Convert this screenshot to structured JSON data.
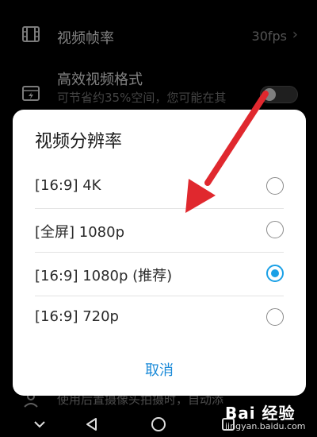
{
  "settings": {
    "frame_rate": {
      "title": "视频帧率",
      "value": "30fps",
      "icon": "film-icon"
    },
    "hevc": {
      "title": "高效视频格式",
      "subtitle": "可节省约35%空间，您可能在其",
      "icon": "hevc-icon",
      "toggle_on": false
    },
    "bottom_row_text": "使用后置摄像头拍摄时，自动添"
  },
  "dialog": {
    "title": "视频分辨率",
    "options": [
      {
        "label": "[16:9] 4K",
        "selected": false
      },
      {
        "label": "[全屏] 1080p",
        "selected": false
      },
      {
        "label": "[16:9] 1080p (推荐)",
        "selected": true
      },
      {
        "label": "[16:9] 720p",
        "selected": false
      }
    ],
    "cancel_label": "取消"
  },
  "colors": {
    "accent": "#1aa0e6",
    "annotation_arrow": "#e0282e"
  },
  "watermark": {
    "text": "Bai 经验",
    "url": "jingyan.baidu.com"
  },
  "nav": [
    "back-icon",
    "home-icon",
    "recents-icon",
    "hide-keyboard-icon"
  ]
}
